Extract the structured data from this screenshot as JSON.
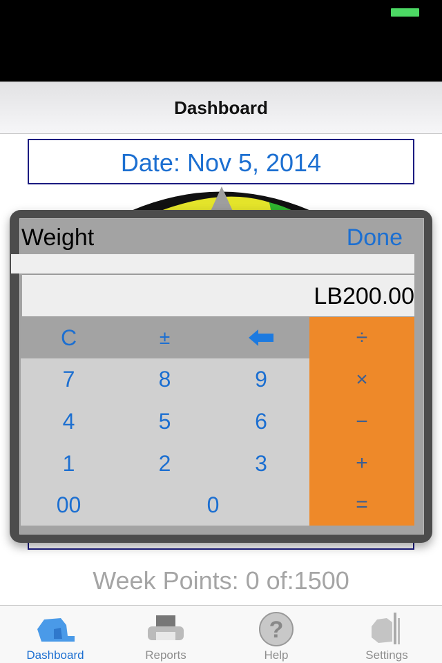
{
  "status_bar": {
    "battery_color": "#4cd964"
  },
  "nav": {
    "title": "Dashboard"
  },
  "date": {
    "label": "Date: Nov 5, 2014"
  },
  "popover": {
    "title": "Weight",
    "done_label": "Done",
    "display_value": "LB200.00"
  },
  "keypad": {
    "top_row": [
      {
        "label": "C",
        "name": "clear-key"
      },
      {
        "label": "±",
        "name": "plus-minus-key"
      },
      {
        "label": "",
        "name": "backspace-key",
        "icon": "backspace-arrow-icon"
      }
    ],
    "digits": [
      [
        "7",
        "8",
        "9"
      ],
      [
        "4",
        "5",
        "6"
      ],
      [
        "1",
        "2",
        "3"
      ]
    ],
    "bottom_row": [
      {
        "label": "00",
        "name": "double-zero-key"
      },
      {
        "label": "0",
        "name": "zero-key"
      }
    ],
    "operators": [
      "÷",
      "×",
      "−",
      "+",
      "="
    ]
  },
  "week_points": {
    "label": "Week Points: 0 of:1500"
  },
  "tabs": [
    {
      "label": "Dashboard",
      "icon": "dashboard-icon",
      "active": true
    },
    {
      "label": "Reports",
      "icon": "printer-icon",
      "active": false
    },
    {
      "label": "Help",
      "icon": "help-icon",
      "active": false
    },
    {
      "label": "Settings",
      "icon": "settings-icon",
      "active": false
    }
  ],
  "colors": {
    "accent": "#1c6fd1",
    "operator_bg": "#ee8929",
    "operator_text": "#3c5f93",
    "gauge_yellow": "#e4e42a",
    "gauge_green": "#2fb52f"
  }
}
